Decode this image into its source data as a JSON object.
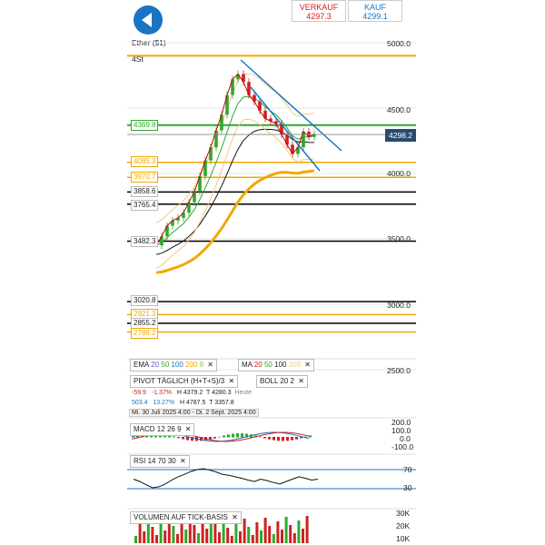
{
  "header": {
    "sell_label": "VERKAUF",
    "sell_value": "4297.3",
    "buy_label": "KAUF",
    "buy_value": "4299.1"
  },
  "chart_title": "Ether ($1)",
  "timeframe": "4St",
  "current_price": "4298.2",
  "y_ticks": [
    "5000.0",
    "4500.0",
    "4000.0",
    "3500.0",
    "3000.0",
    "2500.0"
  ],
  "level_labels": [
    {
      "text": "4369.8",
      "color": "#2ea82e"
    },
    {
      "text": "4085.3",
      "color": "#f0a800"
    },
    {
      "text": "3970.7",
      "color": "#f0a800"
    },
    {
      "text": "3858.6",
      "color": "#000000"
    },
    {
      "text": "3765.4",
      "color": "#000000"
    },
    {
      "text": "3482.3",
      "color": "#000000"
    },
    {
      "text": "3020.8",
      "color": "#000000"
    },
    {
      "text": "2921.3",
      "color": "#f0a800"
    },
    {
      "text": "2855.2",
      "color": "#000000"
    },
    {
      "text": "2788.2",
      "color": "#f0a800"
    }
  ],
  "indicators": {
    "ema": {
      "label": "EMA",
      "p1": "20",
      "p2": "50",
      "p3": "100",
      "p4": "200",
      "p5": "9"
    },
    "ma": {
      "label": "MA",
      "p1": "20",
      "p2": "50",
      "p3": "100",
      "p4": "200"
    },
    "pivot": {
      "label": "PIVOT",
      "mode": "TÄGLICH",
      "formula": "(H+T+S)/3"
    },
    "boll": {
      "label": "BOLL",
      "p1": "20",
      "p2": "2"
    },
    "macd": {
      "label": "MACD",
      "p1": "12",
      "p2": "26",
      "p3": "9"
    },
    "rsi": {
      "label": "RSI",
      "p1": "14",
      "p2": "70",
      "p3": "30"
    },
    "volume": {
      "label": "VOLUMEN AUF TICK-BASIS"
    }
  },
  "info_rows": {
    "change": "-59.9",
    "change_pct": "-1.37%",
    "high": "H 4379.2",
    "low": "T 4280.3",
    "today": "Heute",
    "v1": "503.4",
    "v1_pct": "13.27%",
    "high2": "H 4787.5",
    "low2": "T 3357.8",
    "range": "Mi. 30 Juli 2025 4:00 - Di. 2 Sept. 2025 4:00"
  },
  "macd_ticks": [
    "200.0",
    "100.0",
    "0.0",
    "-100.0"
  ],
  "rsi_ticks": [
    "70",
    "30"
  ],
  "volume_ticks": [
    "30K",
    "20K",
    "10K"
  ],
  "colors": {
    "accent_blue": "#1a74c4",
    "sell_red": "#d02020",
    "up": "#2ea82e",
    "down": "#d02020",
    "gold": "#f0a800",
    "trend": "#1a74c4"
  },
  "chart_data": {
    "type": "line",
    "title": "Ether ($1)",
    "ylim": [
      2500,
      5000
    ],
    "price_path": [
      3450,
      3520,
      3600,
      3640,
      3660,
      3700,
      3780,
      3860,
      3980,
      4100,
      4200,
      4330,
      4450,
      4600,
      4720,
      4760,
      4700,
      4600,
      4550,
      4480,
      4420,
      4400,
      4380,
      4300,
      4220,
      4150,
      4200,
      4320,
      4280,
      4300
    ],
    "horizontal_levels": [
      4900,
      4369.8,
      4085.3,
      3970.7,
      3858.6,
      3765.4,
      3482.3,
      3020.8,
      2921.3,
      2855.2,
      2788.2
    ],
    "rsi_ylim": [
      0,
      100
    ]
  }
}
